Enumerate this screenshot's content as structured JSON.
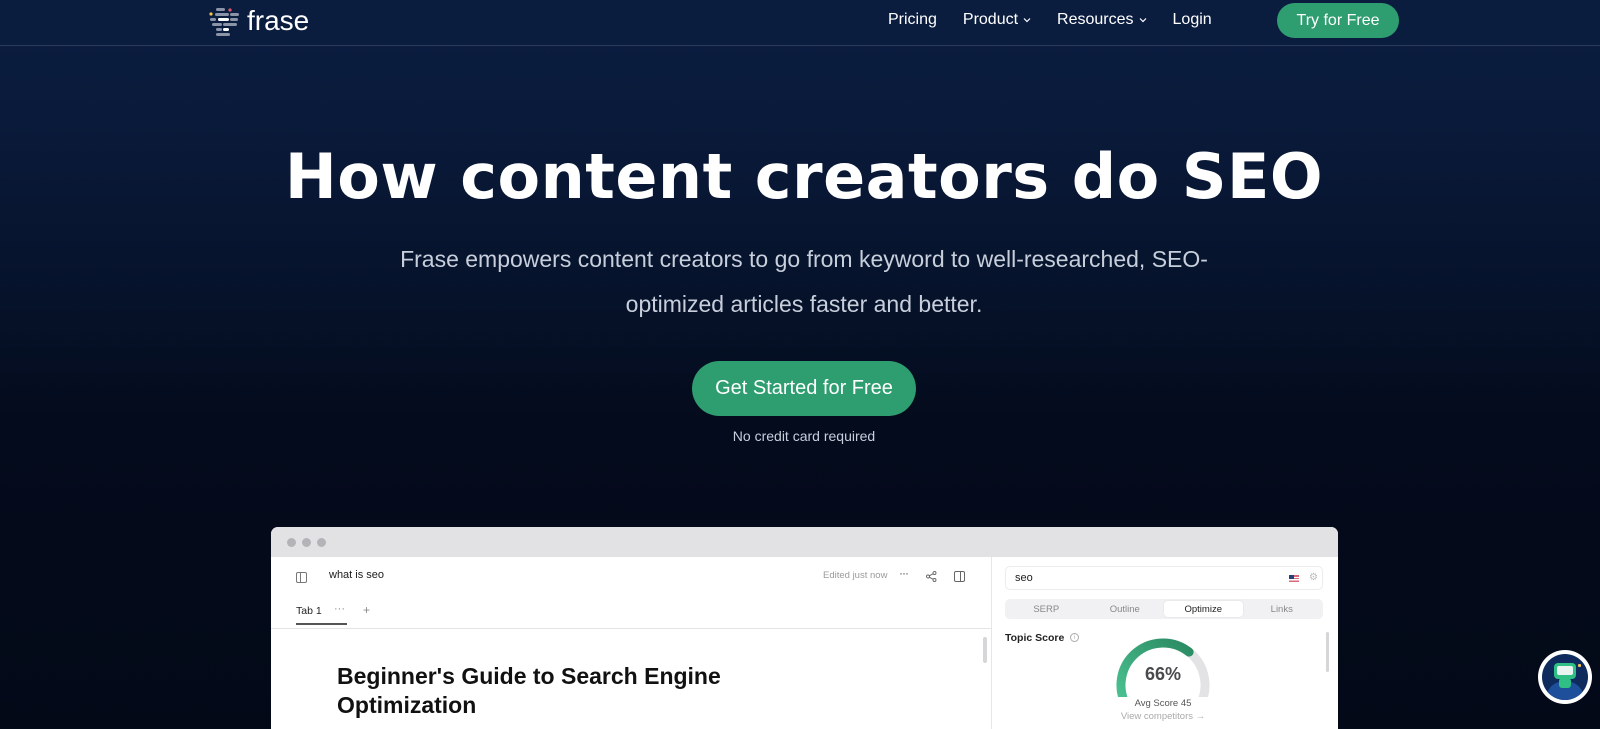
{
  "nav": {
    "logo_text": "frase",
    "logo_icon": "frase-lines-logo-icon",
    "links": [
      {
        "label": "Pricing",
        "has_dropdown": false
      },
      {
        "label": "Product",
        "has_dropdown": true
      },
      {
        "label": "Resources",
        "has_dropdown": true
      },
      {
        "label": "Login",
        "has_dropdown": false
      }
    ],
    "cta_label": "Try for Free"
  },
  "hero": {
    "title": "How content creators do SEO",
    "subtitle": "Frase empowers content creators to go from keyword to well-researched, SEO-optimized articles faster and better.",
    "cta_label": "Get Started for Free",
    "note": "No credit card required"
  },
  "mockup": {
    "editor": {
      "doc_title": "what is seo",
      "status": "Edited just now",
      "more_icon": "ellipsis-icon",
      "tab_label": "Tab 1",
      "tab_more": "···",
      "tab_add": "+",
      "heading": "Beginner's Guide to Search Engine Optimization"
    },
    "panel": {
      "search_value": "seo",
      "country": "US",
      "tabs": [
        {
          "label": "SERP",
          "active": false
        },
        {
          "label": "Outline",
          "active": false
        },
        {
          "label": "Optimize",
          "active": true
        },
        {
          "label": "Links",
          "active": false
        }
      ],
      "topic_score_label": "Topic Score",
      "topic_score_value": "66%",
      "topic_score_fraction": 0.66,
      "avg_score_label": "Avg Score 45",
      "view_competitors": "View competitors →"
    }
  },
  "colors": {
    "brand_green": "#2e9d6f",
    "nav_bg": "#0b1d3f",
    "hero_bg_bottom": "#030917"
  },
  "chat_widget": {
    "icon": "robot-assistant-icon"
  }
}
